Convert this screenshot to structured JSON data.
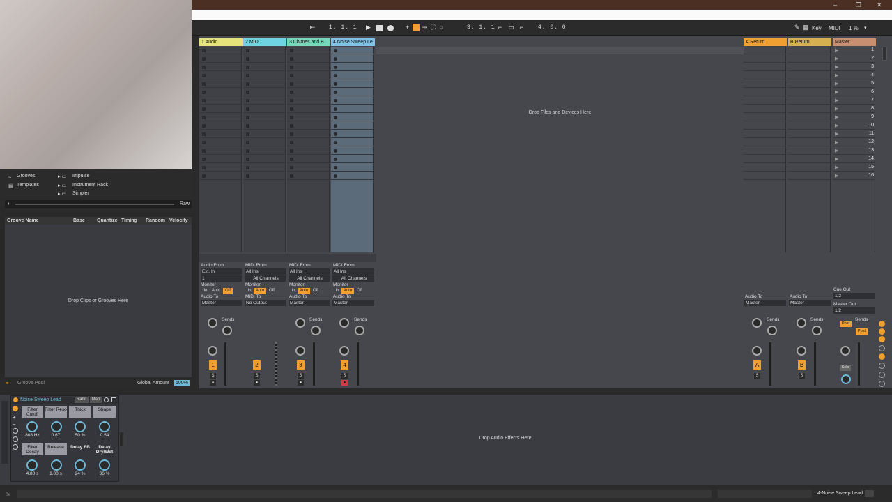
{
  "window": {
    "minimize": "–",
    "restore": "❐",
    "close": "✕"
  },
  "transport": {
    "arrangement_pos": "1.  1.  1",
    "loop_start": "3.  1.  1",
    "loop_length": "4.  0.  0",
    "key_label": "Key",
    "midi_label": "MIDI",
    "cpu": "1 %"
  },
  "browser": {
    "items_left": [
      "Grooves",
      "Templates"
    ],
    "items_right": [
      "Impulse",
      "Instrument Rack",
      "Simpler"
    ],
    "raw_label": "Raw"
  },
  "groove_pool": {
    "columns": [
      "Groove Name",
      "Base",
      "Quantize",
      "Timing",
      "Random",
      "Velocity"
    ],
    "empty_text": "Drop Clips or Grooves Here",
    "title": "Groove Pool",
    "global_amount_label": "Global Amount",
    "global_amount_value": "100%"
  },
  "tracks": [
    {
      "name": "1 Audio",
      "color": "#e6e37a",
      "number": "1",
      "from_label": "Audio From",
      "from": "Ext. In",
      "channel": "1",
      "to_label": "Audio To",
      "to": "Master"
    },
    {
      "name": "2 MIDI",
      "color": "#6fd3e3",
      "number": "2",
      "from_label": "MIDI From",
      "from": "All Ins",
      "channel": "All Channels",
      "to_label": "MIDI To",
      "to": "No Output"
    },
    {
      "name": "3 Chimes and B",
      "color": "#76d8b8",
      "number": "3",
      "from_label": "MIDI From",
      "from": "All Ins",
      "channel": "All Channels",
      "to_label": "Audio To",
      "to": "Master"
    },
    {
      "name": "4 Noise Sweep Le",
      "color": "#7ec3e6",
      "number": "4",
      "from_label": "MIDI From",
      "from": "All Ins",
      "channel": "All Channels",
      "to_label": "Audio To",
      "to": "Master"
    }
  ],
  "monitor": {
    "label": "Monitor",
    "in": "In",
    "auto": "Auto",
    "off": "Off"
  },
  "sends_label": "Sends",
  "drop_files_text": "Drop Files and Devices Here",
  "returns": [
    {
      "name": "A Return",
      "color": "#f0a030",
      "letter": "A",
      "to_label": "Audio To",
      "to": "Master"
    },
    {
      "name": "B Return",
      "color": "#d6b050",
      "letter": "B",
      "to_label": "Audio To",
      "to": "Master"
    }
  ],
  "master": {
    "name": "Master",
    "color": "#c89070",
    "cue_label": "Cue Out",
    "cue": "1/2",
    "out_label": "Master Out",
    "out": "1/2",
    "post": "Post",
    "solo": "Solo"
  },
  "scene_numbers": [
    "1",
    "2",
    "3",
    "4",
    "5",
    "6",
    "7",
    "8",
    "9",
    "10",
    "11",
    "12",
    "13",
    "14",
    "15",
    "16"
  ],
  "device": {
    "name": "Noise Sweep Lead",
    "rand": "Rand",
    "map": "Map",
    "params": [
      {
        "label": "Filter Cutoff",
        "value": "808 Hz"
      },
      {
        "label": "Filter Reso",
        "value": "0.67"
      },
      {
        "label": "Thick",
        "value": "50 %"
      },
      {
        "label": "Shape",
        "value": "0.54"
      },
      {
        "label": "Filter Decay",
        "value": "4.80 s"
      },
      {
        "label": "Release",
        "value": "1.00 s"
      },
      {
        "label": "Delay FB",
        "value": "24 %"
      },
      {
        "label": "Delay Dry/Wet",
        "value": "36 %"
      }
    ]
  },
  "effects_drop_text": "Drop Audio Effects Here",
  "status": {
    "track_name": "4-Noise Sweep Lead"
  },
  "colors": {
    "accent": "#f0a030",
    "background": "#45474d"
  }
}
